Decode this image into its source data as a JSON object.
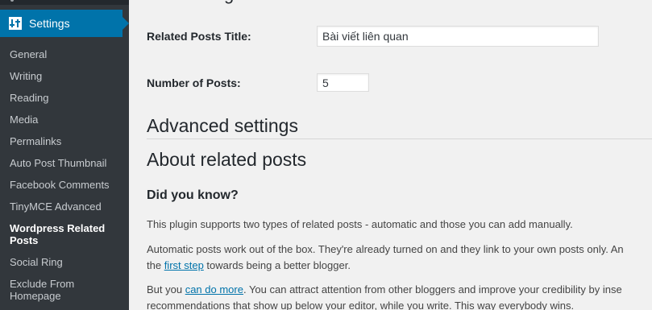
{
  "sidebar": {
    "settings_label": "Settings",
    "items": [
      {
        "label": "General"
      },
      {
        "label": "Writing"
      },
      {
        "label": "Reading"
      },
      {
        "label": "Media"
      },
      {
        "label": "Permalinks"
      },
      {
        "label": "Auto Post Thumbnail"
      },
      {
        "label": "Facebook Comments"
      },
      {
        "label": "TinyMCE Advanced"
      },
      {
        "label": "Wordpress Related Posts",
        "current": true
      },
      {
        "label": "Social Ring"
      },
      {
        "label": "Exclude From Homepage"
      }
    ],
    "icon": "settings-sliders-icon",
    "colors": {
      "bg": "#32373c",
      "active": "#0073aa",
      "text": "#c8ccd0"
    }
  },
  "main": {
    "fields": {
      "title_label": "Related Posts Title:",
      "title_value": "Bài viết liên quan",
      "count_label": "Number of Posts:",
      "count_value": "5"
    },
    "advanced_heading": "Advanced settings",
    "about_heading": "About related posts",
    "did_you_know": "Did you know?",
    "p1": "This plugin supports two types of related posts - automatic and those you can add manually.",
    "p2_line1": "Automatic posts work out of the box. They're already turned on and they link to your own posts only. An",
    "p2_pre": "the ",
    "p2_link": "first step",
    "p2_post": " towards being a better blogger.",
    "p3_pre": "But you ",
    "p3_link": "can do more",
    "p3_post": ". You can attract attention from other bloggers and improve your credibility by inse",
    "p3_line2": "recommendations that show up below your editor, while you write. This way everybody wins."
  }
}
